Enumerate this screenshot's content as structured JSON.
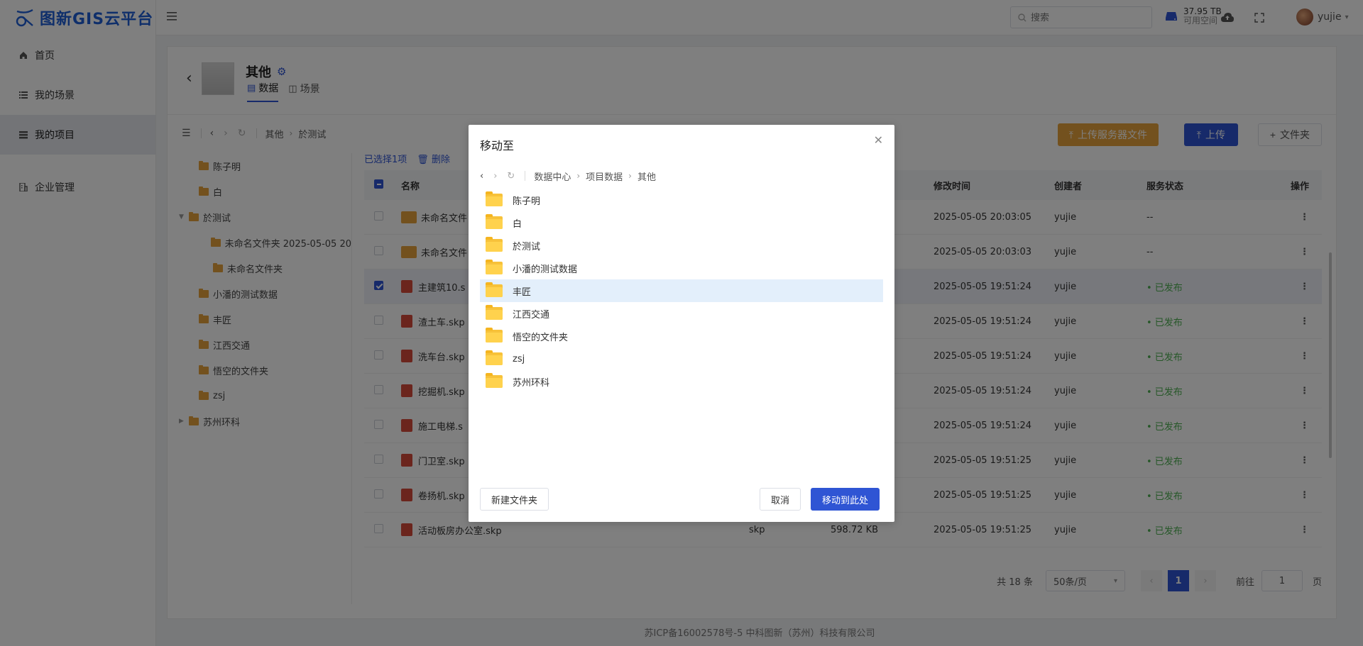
{
  "app": {
    "title": "图新GIS云平台"
  },
  "sidebar": {
    "items": [
      {
        "label": "首页",
        "icon": "home-icon"
      },
      {
        "label": "我的场景",
        "icon": "list-icon"
      },
      {
        "label": "我的项目",
        "icon": "project-icon",
        "active": true
      },
      {
        "label": "企业管理",
        "icon": "building-icon"
      }
    ]
  },
  "header": {
    "search_placeholder": "搜索",
    "storage_value": "37.95 TB",
    "storage_label": "可用空间",
    "username": "yujie"
  },
  "project": {
    "title": "其他",
    "tabs": [
      {
        "label": "数据",
        "active": true
      },
      {
        "label": "场景"
      }
    ]
  },
  "toolbar": {
    "breadcrumb": [
      "其他",
      "於测试"
    ],
    "upload_server_label": "上传服务器文件",
    "upload_label": "上传",
    "new_folder_label": "文件夹"
  },
  "tree": {
    "items": [
      {
        "label": "陈子明",
        "level": 0
      },
      {
        "label": "白",
        "level": 0
      },
      {
        "label": "於测试",
        "level": 0,
        "expanded": true
      },
      {
        "label": "未命名文件夹 2025-05-05 20",
        "level": 1
      },
      {
        "label": "未命名文件夹",
        "level": 1
      },
      {
        "label": "小潘的测试数据",
        "level": 0
      },
      {
        "label": "丰匠",
        "level": 0
      },
      {
        "label": "江西交通",
        "level": 0
      },
      {
        "label": "悟空的文件夹",
        "level": 0
      },
      {
        "label": "zsj",
        "level": 0
      },
      {
        "label": "苏州环科",
        "level": 0,
        "collapsed": true
      }
    ]
  },
  "files": {
    "selection_text": "已选择1项",
    "delete_label": "删除",
    "columns": [
      "名称",
      "修改时间",
      "创建者",
      "服务状态",
      "操作"
    ],
    "rows": [
      {
        "name": "未命名文件",
        "kind": "folder",
        "type": "",
        "size": "",
        "time": "2025-05-05 20:03:05",
        "creator": "yujie",
        "status": "--"
      },
      {
        "name": "未命名文件",
        "kind": "folder",
        "type": "",
        "size": "",
        "time": "2025-05-05 20:03:03",
        "creator": "yujie",
        "status": "--"
      },
      {
        "name": "主建筑10.s",
        "kind": "file",
        "type": "",
        "size": "",
        "time": "2025-05-05 19:51:24",
        "creator": "yujie",
        "status": "• 已发布",
        "selected": true
      },
      {
        "name": "渣土车.skp",
        "kind": "file",
        "type": "",
        "size": "",
        "time": "2025-05-05 19:51:24",
        "creator": "yujie",
        "status": "• 已发布"
      },
      {
        "name": "洗车台.skp",
        "kind": "file",
        "type": "",
        "size": "",
        "time": "2025-05-05 19:51:24",
        "creator": "yujie",
        "status": "• 已发布"
      },
      {
        "name": "挖掘机.skp",
        "kind": "file",
        "type": "",
        "size": "",
        "time": "2025-05-05 19:51:24",
        "creator": "yujie",
        "status": "• 已发布"
      },
      {
        "name": "施工电梯.s",
        "kind": "file",
        "type": "",
        "size": "",
        "time": "2025-05-05 19:51:24",
        "creator": "yujie",
        "status": "• 已发布"
      },
      {
        "name": "门卫室.skp",
        "kind": "file",
        "type": "",
        "size": "",
        "time": "2025-05-05 19:51:25",
        "creator": "yujie",
        "status": "• 已发布"
      },
      {
        "name": "卷扬机.skp",
        "kind": "file",
        "type": "",
        "size": "",
        "time": "2025-05-05 19:51:25",
        "creator": "yujie",
        "status": "• 已发布"
      },
      {
        "name": "活动板房办公室.skp",
        "kind": "file",
        "type": "skp",
        "size": "598.72 KB",
        "time": "2025-05-05 19:51:25",
        "creator": "yujie",
        "status": "• 已发布"
      }
    ]
  },
  "pagination": {
    "total": "共 18 条",
    "page_size": "50条/页",
    "current": "1",
    "goto_label": "前往",
    "goto_value": "1",
    "page_unit": "页"
  },
  "footer": {
    "text": "苏ICP备16002578号-5 中科图新（苏州）科技有限公司"
  },
  "modal": {
    "title": "移动至",
    "path": [
      "数据中心",
      "项目数据",
      "其他"
    ],
    "folders": [
      {
        "label": "陈子明"
      },
      {
        "label": "白"
      },
      {
        "label": "於测试"
      },
      {
        "label": "小潘的测试数据"
      },
      {
        "label": "丰匠",
        "highlighted": true
      },
      {
        "label": "江西交通"
      },
      {
        "label": "悟空的文件夹"
      },
      {
        "label": "zsj"
      },
      {
        "label": "苏州环科"
      }
    ],
    "new_folder_label": "新建文件夹",
    "cancel_label": "取消",
    "confirm_label": "移动到此处"
  },
  "colors": {
    "primary": "#2f55d4",
    "warning": "#e6a23c",
    "success": "#4caf50",
    "folder": "#ffd24d"
  }
}
